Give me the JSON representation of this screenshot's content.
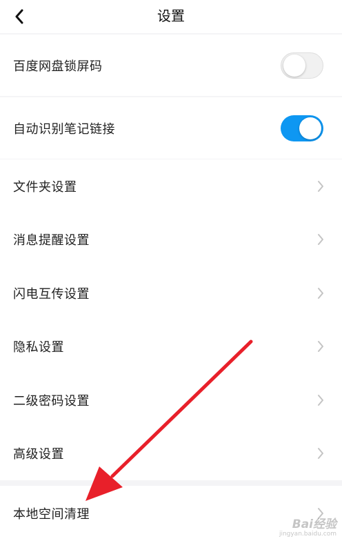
{
  "header": {
    "title": "设置",
    "back_icon": "chevron-left-icon"
  },
  "toggles": [
    {
      "label": "百度网盘锁屏码",
      "state": "off"
    },
    {
      "label": "自动识别笔记链接",
      "state": "on",
      "color": "#0e97f2"
    }
  ],
  "settings": [
    {
      "label": "文件夹设置"
    },
    {
      "label": "消息提醒设置"
    },
    {
      "label": "闪电互传设置"
    },
    {
      "label": "隐私设置"
    },
    {
      "label": "二级密码设置"
    },
    {
      "label": "高级设置"
    }
  ],
  "bottom": [
    {
      "label": "本地空间清理"
    }
  ],
  "annotation": {
    "type": "red-arrow",
    "color": "#e8202a"
  },
  "watermark": {
    "logo": "Bai经验",
    "url": "jingyan.baidu.com"
  }
}
